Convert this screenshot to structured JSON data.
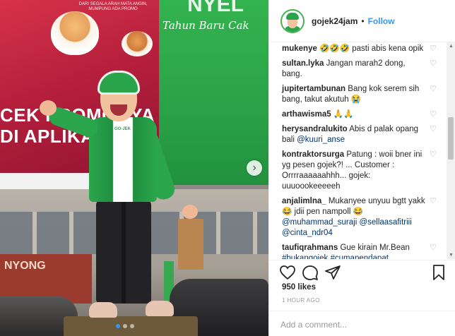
{
  "photo": {
    "billboard_top_text": "DARI SEGALA ARAH MATA ANGIN,\nMUMPUNG ADA PROMO",
    "billboard_big_text": "CEK PROMONYA\nDI APLIKASI",
    "billboard_green_headline": "NYEL",
    "billboard_green_sub": "Tahun Baru Cak",
    "shop_sign_text": "NYONG",
    "jacket_text": "GO-JEK",
    "carousel_next_glyph": "›",
    "dot_count": 3,
    "active_dot": 0
  },
  "header": {
    "username": "gojek24jam",
    "separator": "•",
    "follow_label": "Follow"
  },
  "comments": [
    {
      "user": "mukenye",
      "text": " 🤣🤣🤣 pasti abis kena opik",
      "mentions": []
    },
    {
      "user": "sultan.lyka",
      "text": " Jangan marah2 dong, bang.",
      "mentions": []
    },
    {
      "user": "jupitertambunan",
      "text": " Bang kok serem sih bang, takut akutuh 😭",
      "mentions": []
    },
    {
      "user": "arthawisma5",
      "text": " 🙏🙏",
      "mentions": []
    },
    {
      "user": "herysandralukito",
      "text": " Abis d palak opang bali ",
      "mentions": [
        "@kuuri_anse"
      ]
    },
    {
      "user": "kontraktorsurga",
      "text": " Patung : woii bner ini yg pesen gojek?! ... Customer : Orrrraaaaaahhh... gojek: uuuoookeeeeeh",
      "mentions": []
    },
    {
      "user": "anjalimlna_",
      "text": " Mukanyee unyuu bgtt yakk 😂 jdii pen nampoll 😂 ",
      "mentions": [
        "@muhammad_suraji",
        "@sellaasafitriii",
        "@cinta_ndr04"
      ]
    },
    {
      "user": "taufiqrahmans",
      "text": " Gue kirain Mr.Bean ",
      "mentions": [
        "#bukangojek",
        "#cumapendapat"
      ]
    }
  ],
  "heart_glyph": "♡",
  "actions": {
    "like": "heart-outline-icon",
    "comment": "comment-bubble-icon",
    "share": "share-arrow-icon",
    "save": "bookmark-icon"
  },
  "likes": "950 likes",
  "time_ago": "1 HOUR AGO",
  "add_comment": {
    "placeholder": "Add a comment..."
  },
  "colors": {
    "accent_blue": "#3897f0",
    "gojek_green": "#2aa44b",
    "text": "#262626",
    "muted": "#999999"
  }
}
